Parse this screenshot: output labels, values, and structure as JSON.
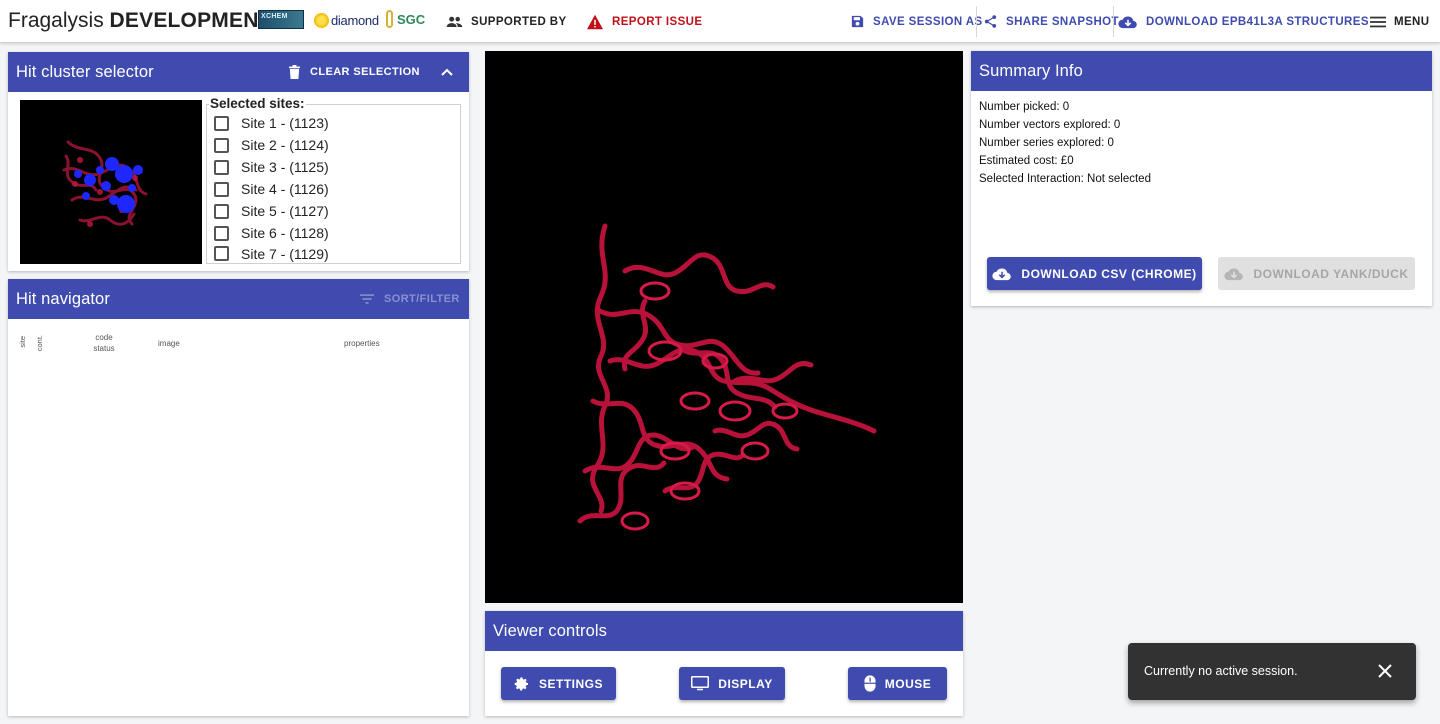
{
  "header": {
    "brand_light": "Fragalysis",
    "brand_bold": "DEVELOPMENT",
    "logos": {
      "xchem": "XCHEM",
      "diamond": "diamond",
      "sgc": "SGC"
    },
    "supported_by": "SUPPORTED BY",
    "report_issue": "REPORT ISSUE",
    "save_session": "SAVE SESSION AS",
    "share_snapshot": "SHARE SNAPSHOT",
    "download_structures": "DOWNLOAD EPB41L3A STRUCTURES",
    "menu": "MENU"
  },
  "hit_cluster": {
    "title": "Hit cluster selector",
    "clear_selection": "CLEAR SELECTION",
    "selected_sites_label": "Selected sites:",
    "sites": [
      {
        "label": "Site 1 - (1123)",
        "checked": false
      },
      {
        "label": "Site 2 - (1124)",
        "checked": false
      },
      {
        "label": "Site 3 - (1125)",
        "checked": false
      },
      {
        "label": "Site 4 - (1126)",
        "checked": false
      },
      {
        "label": "Site 5 - (1127)",
        "checked": false
      },
      {
        "label": "Site 6 - (1128)",
        "checked": false
      },
      {
        "label": "Site 7 - (1129)",
        "checked": false
      }
    ]
  },
  "hit_navigator": {
    "title": "Hit navigator",
    "sort_filter": "SORT/FILTER",
    "columns": {
      "site": "site",
      "cont": "cont.",
      "code": "code",
      "status": "status",
      "image": "image",
      "properties": "properties"
    }
  },
  "viewer_controls": {
    "title": "Viewer controls",
    "settings": "SETTINGS",
    "display": "DISPLAY",
    "mouse": "MOUSE"
  },
  "summary": {
    "title": "Summary Info",
    "lines": [
      "Number picked: 0",
      "Number vectors explored: 0",
      "Number series explored: 0",
      "Estimated cost: £0",
      "Selected Interaction: Not selected"
    ],
    "download_csv": "DOWNLOAD CSV (CHROME)",
    "download_yank": "DOWNLOAD YANK/DUCK"
  },
  "snackbar": {
    "message": "Currently no active session."
  },
  "colors": {
    "primary": "#3f4baf",
    "danger": "#c0111a",
    "protein": "#c8163f",
    "ligand": "#1f27ff"
  },
  "icons": {
    "supported_by": "people-icon",
    "report": "warning-icon",
    "save": "floppy-icon",
    "share": "share-icon",
    "download": "cloud-download-icon",
    "menu": "hamburger-icon",
    "delete": "trash-icon",
    "collapse": "chevron-up-icon",
    "filter": "filter-icon",
    "settings": "gear-icon",
    "display": "monitor-icon",
    "mouse": "mouse-icon",
    "close": "close-icon"
  }
}
